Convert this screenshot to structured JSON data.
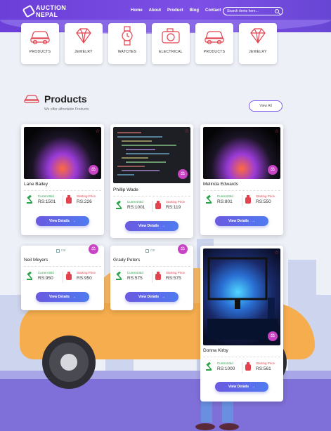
{
  "brand": {
    "name_line1": "AUCTION",
    "name_line2": "NEPAL"
  },
  "nav": [
    "Home",
    "About",
    "Product",
    "Blog",
    "Contact"
  ],
  "search": {
    "placeholder": "Search items here..."
  },
  "categories": [
    {
      "label": "PRODUCTS",
      "icon": "car-icon"
    },
    {
      "label": "JEWELRY",
      "icon": "diamond-icon"
    },
    {
      "label": "WATCHES",
      "icon": "watch-icon"
    },
    {
      "label": "ELECTRICAL",
      "icon": "camera-icon"
    },
    {
      "label": "PRODUCTS",
      "icon": "car-icon"
    },
    {
      "label": "JEWELRY",
      "icon": "diamond-icon"
    }
  ],
  "section": {
    "title": "Products",
    "subtitle": "We offer affordable Products",
    "view_all": "View All"
  },
  "labels": {
    "current_bid": "Current Bid",
    "starting_price": "Starting Price",
    "view_details": "View Details",
    "broken_alt": "car"
  },
  "products": [
    {
      "name": "Lane Bailey",
      "current_bid": "RS:1501",
      "starting_price": "RS:226"
    },
    {
      "name": "Phillip Wade",
      "current_bid": "RS:1001",
      "starting_price": "RS:119"
    },
    {
      "name": "Melinda Edwards",
      "current_bid": "RS:801",
      "starting_price": "RS:550"
    },
    {
      "name": "Neil Meyers",
      "current_bid": "RS:950",
      "starting_price": "RS:950"
    },
    {
      "name": "Grady Peters",
      "current_bid": "RS:575",
      "starting_price": "RS:575"
    },
    {
      "name": "Donna Kirby",
      "current_bid": "RS:1000",
      "starting_price": "RS:561"
    }
  ],
  "colors": {
    "brand": "#6b3fd8",
    "accent_green": "#2aa34a",
    "accent_red": "#e2434f",
    "button": "#5a66e8"
  }
}
